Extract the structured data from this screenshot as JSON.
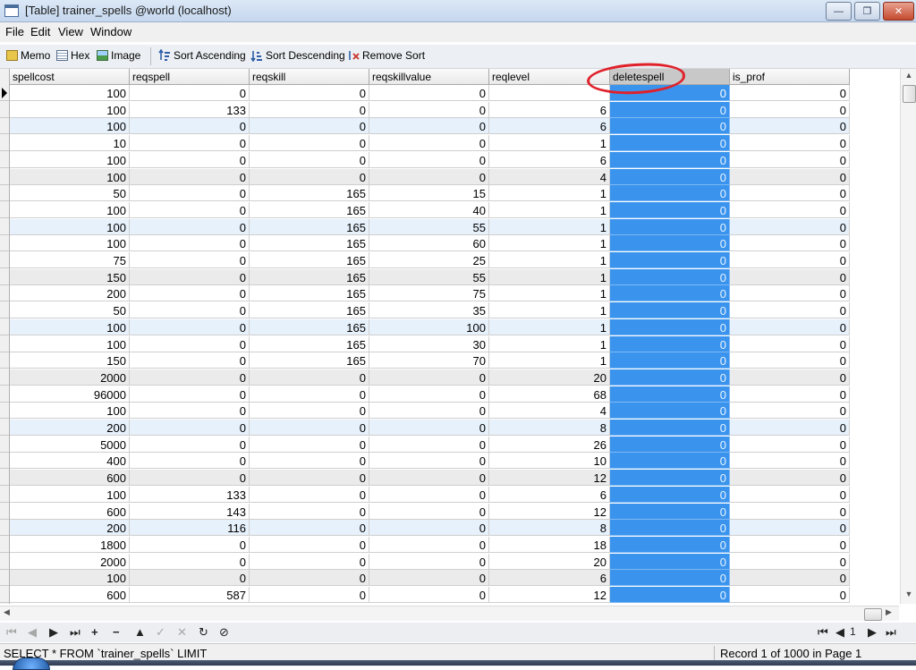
{
  "window": {
    "title": "[Table] trainer_spells @world (localhost)",
    "minimize_glyph": "—",
    "maximize_glyph": "❐",
    "close_glyph": "✕"
  },
  "menu": [
    "File",
    "Edit",
    "View",
    "Window"
  ],
  "toolbar": {
    "memo": "Memo",
    "hex": "Hex",
    "image": "Image",
    "sort_asc": "Sort Ascending",
    "sort_desc": "Sort Descending",
    "remove_sort": "Remove Sort"
  },
  "grid": {
    "columns": [
      "spellcost",
      "reqspell",
      "reqskill",
      "reqskillvalue",
      "reqlevel",
      "deletespell",
      "is_prof"
    ],
    "selected_column": "deletespell",
    "rows": [
      [
        100,
        0,
        0,
        0,
        "",
        0,
        0
      ],
      [
        100,
        133,
        0,
        0,
        6,
        0,
        0
      ],
      [
        100,
        0,
        0,
        0,
        6,
        0,
        0
      ],
      [
        10,
        0,
        0,
        0,
        1,
        0,
        0
      ],
      [
        100,
        0,
        0,
        0,
        6,
        0,
        0
      ],
      [
        100,
        0,
        0,
        0,
        4,
        0,
        0
      ],
      [
        50,
        0,
        165,
        15,
        1,
        0,
        0
      ],
      [
        100,
        0,
        165,
        40,
        1,
        0,
        0
      ],
      [
        100,
        0,
        165,
        55,
        1,
        0,
        0
      ],
      [
        100,
        0,
        165,
        60,
        1,
        0,
        0
      ],
      [
        75,
        0,
        165,
        25,
        1,
        0,
        0
      ],
      [
        150,
        0,
        165,
        55,
        1,
        0,
        0
      ],
      [
        200,
        0,
        165,
        75,
        1,
        0,
        0
      ],
      [
        50,
        0,
        165,
        35,
        1,
        0,
        0
      ],
      [
        100,
        0,
        165,
        100,
        1,
        0,
        0
      ],
      [
        100,
        0,
        165,
        30,
        1,
        0,
        0
      ],
      [
        150,
        0,
        165,
        70,
        1,
        0,
        0
      ],
      [
        2000,
        0,
        0,
        0,
        20,
        0,
        0
      ],
      [
        96000,
        0,
        0,
        0,
        68,
        0,
        0
      ],
      [
        100,
        0,
        0,
        0,
        4,
        0,
        0
      ],
      [
        200,
        0,
        0,
        0,
        8,
        0,
        0
      ],
      [
        5000,
        0,
        0,
        0,
        26,
        0,
        0
      ],
      [
        400,
        0,
        0,
        0,
        10,
        0,
        0
      ],
      [
        600,
        0,
        0,
        0,
        12,
        0,
        0
      ],
      [
        100,
        133,
        0,
        0,
        6,
        0,
        0
      ],
      [
        600,
        143,
        0,
        0,
        12,
        0,
        0
      ],
      [
        200,
        116,
        0,
        0,
        8,
        0,
        0
      ],
      [
        1800,
        0,
        0,
        0,
        18,
        0,
        0
      ],
      [
        2000,
        0,
        0,
        0,
        20,
        0,
        0
      ],
      [
        100,
        0,
        0,
        0,
        6,
        0,
        0
      ],
      [
        600,
        587,
        0,
        0,
        12,
        0,
        0
      ]
    ]
  },
  "navigator": {
    "first": "⏮",
    "prev": "◀",
    "next": "▶",
    "last": "⏭",
    "insert": "+",
    "delete": "−",
    "edit": "▲",
    "post": "✓",
    "cancel": "✕",
    "refresh": "↻",
    "stop": "⊘",
    "page_first": "⏮",
    "page_prev": "◀",
    "page_number": "1",
    "page_next": "▶",
    "page_last": "⏭"
  },
  "status": {
    "sql": "SELECT * FROM `trainer_spells` LIMIT",
    "record": "Record 1 of 1000 in Page 1"
  },
  "colors": {
    "selection": "#3a94ee",
    "annotation": "#e0212b"
  }
}
